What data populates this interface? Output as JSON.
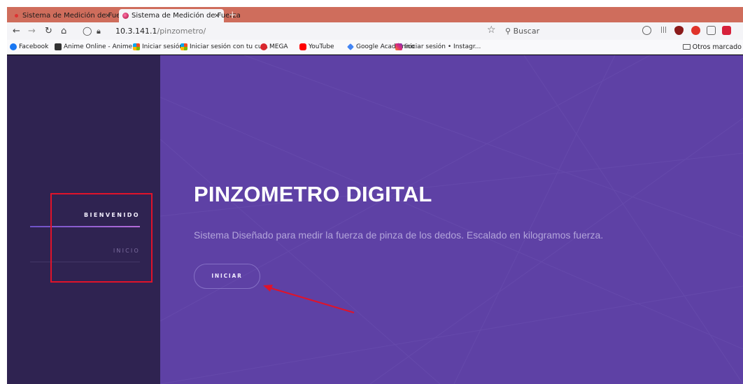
{
  "browser": {
    "tabs": [
      {
        "title": "Sistema de Medición de Fuerza",
        "close": "×"
      },
      {
        "title": "Sistema de Medición de Fuerza",
        "close": "×"
      }
    ],
    "new_tab": "+",
    "url_host": "10.3.141.1",
    "url_path": "/pinzometro/",
    "search_placeholder": "Buscar",
    "bookmarks": [
      "Facebook",
      "Anime Online - Anime...",
      "Iniciar sesión",
      "Iniciar sesión con tu cu...",
      "MEGA",
      "YouTube",
      "Google Académico",
      "Iniciar sesión • Instagr..."
    ],
    "other_bookmarks": "Otros marcado"
  },
  "sidebar": {
    "items": [
      {
        "label": "BIENVENIDO",
        "active": true
      },
      {
        "label": "INICIO",
        "active": false
      }
    ]
  },
  "hero": {
    "title": "PINZOMETRO DIGITAL",
    "subtitle": "Sistema Diseñado para medir la fuerza de pinza de los dedos. Escalado en kilogramos fuerza.",
    "button_label": "INICIAR"
  },
  "colors": {
    "tabstrip": "#cf6d5c",
    "sidebar": "#2f2351",
    "hero": "#5e41a5",
    "annotation": "#e0132a"
  },
  "icons": [
    "back-icon",
    "forward-icon",
    "reload-icon",
    "home-icon",
    "shield-icon",
    "lock-icon",
    "star-icon",
    "search-icon",
    "pocket-icon",
    "library-icon",
    "ublock-icon",
    "adblock-icon",
    "sidebar-icon",
    "extension-icon",
    "folder-icon"
  ]
}
